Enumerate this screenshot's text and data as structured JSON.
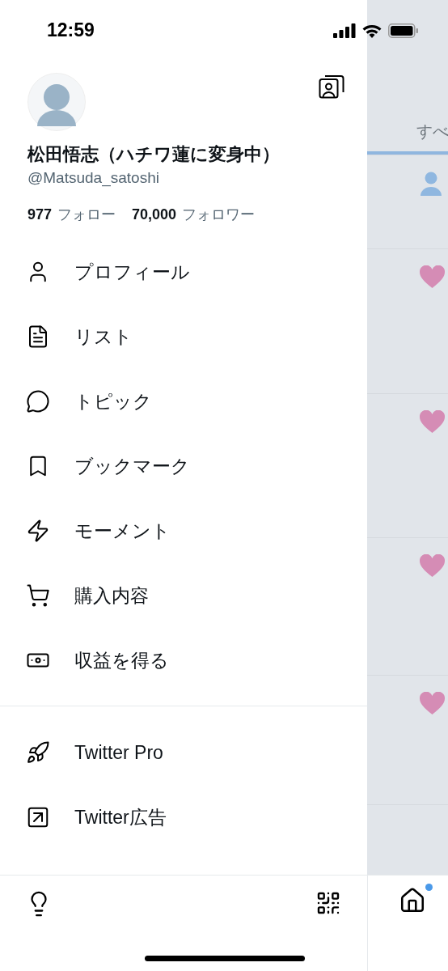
{
  "status_bar": {
    "time": "12:59"
  },
  "profile": {
    "name": "松田悟志（ハチワ蓮に変身中）",
    "handle": "@Matsuda_satoshi",
    "following_count": "977",
    "following_label": "フォロー",
    "followers_count": "70,000",
    "followers_label": "フォロワー"
  },
  "menu": {
    "items": [
      {
        "label": "プロフィール",
        "kind": "profile"
      },
      {
        "label": "リスト",
        "kind": "list"
      },
      {
        "label": "トピック",
        "kind": "topic"
      },
      {
        "label": "ブックマーク",
        "kind": "bookmark"
      },
      {
        "label": "モーメント",
        "kind": "moment"
      },
      {
        "label": "購入内容",
        "kind": "purchase"
      },
      {
        "label": "収益を得る",
        "kind": "earn"
      }
    ]
  },
  "secondary_menu": {
    "items": [
      {
        "label": "Twitter Pro",
        "kind": "rocket"
      },
      {
        "label": "Twitter広告",
        "kind": "ads"
      }
    ]
  },
  "background": {
    "tab": {
      "label": "すべ",
      "selected": true
    },
    "rows": [
      {
        "kind": "follow"
      },
      {
        "kind": "like"
      },
      {
        "kind": "like"
      },
      {
        "kind": "like"
      },
      {
        "kind": "like"
      }
    ],
    "home_nav": {
      "has_new": true
    }
  }
}
